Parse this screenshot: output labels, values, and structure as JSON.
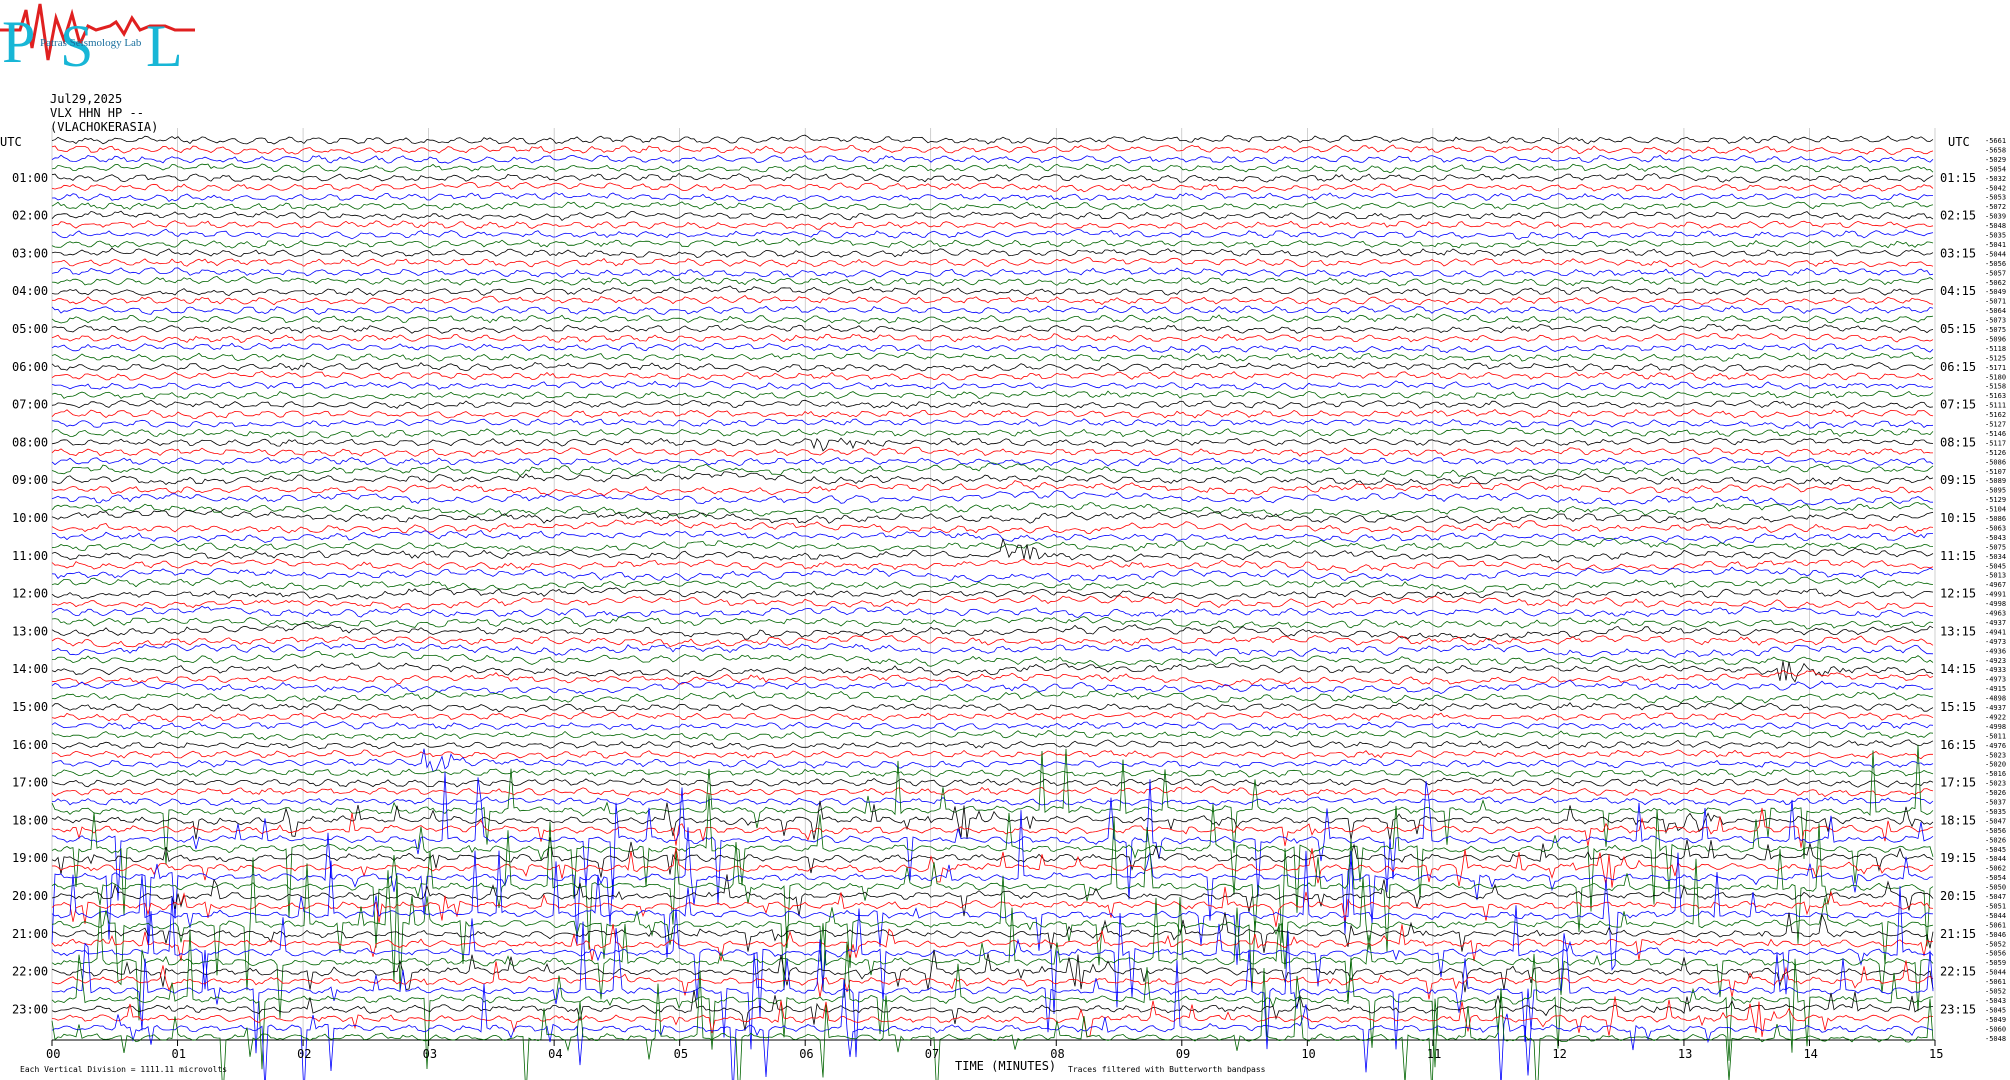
{
  "header": {
    "logo_letters": [
      "P",
      "S",
      "L"
    ],
    "logo_text": "Patras Seismology Lab",
    "date": "Jul29,2025",
    "station": "VLX HHN HP --",
    "location": "(VLACHOKERASIA)"
  },
  "chart_data": {
    "type": "line",
    "title": "",
    "xlabel": "TIME (MINUTES)",
    "ylabel": "UTC",
    "x_ticks": [
      "00",
      "01",
      "02",
      "03",
      "04",
      "05",
      "06",
      "07",
      "08",
      "09",
      "10",
      "11",
      "12",
      "13",
      "14",
      "15"
    ],
    "xlim": [
      0,
      15
    ],
    "left_labels": [
      "01:00",
      "02:00",
      "03:00",
      "04:00",
      "05:00",
      "06:00",
      "07:00",
      "08:00",
      "09:00",
      "10:00",
      "11:00",
      "12:00",
      "13:00",
      "14:00",
      "15:00",
      "16:00",
      "17:00",
      "18:00",
      "19:00",
      "20:00",
      "21:00",
      "22:00",
      "23:00"
    ],
    "right_labels": [
      "01:15",
      "02:15",
      "03:15",
      "04:15",
      "05:15",
      "06:15",
      "07:15",
      "08:15",
      "09:15",
      "10:15",
      "11:15",
      "12:15",
      "13:15",
      "14:15",
      "15:15",
      "16:15",
      "17:15",
      "18:15",
      "19:15",
      "20:15",
      "21:15",
      "22:15",
      "23:15"
    ],
    "utc_label": "UTC",
    "trace_count": 96,
    "trace_colors": [
      "#000000",
      "#ff0000",
      "#0000ff",
      "#006400"
    ],
    "trace_offsets": [
      "-5661",
      "-5658",
      "-5029",
      "-5054",
      "-5032",
      "-5042",
      "-5053",
      "-5072",
      "-5039",
      "-5048",
      "-5035",
      "-5041",
      "-5044",
      "-5056",
      "-5057",
      "-5062",
      "-5049",
      "-5071",
      "-5064",
      "-5073",
      "-5075",
      "-5096",
      "-5118",
      "-5125",
      "-5171",
      "-5180",
      "-5158",
      "-5163",
      "-5111",
      "-5162",
      "-5127",
      "-5146",
      "-5117",
      "-5126",
      "-5086",
      "-5107",
      "-5089",
      "-5095",
      "-5129",
      "-5104",
      "-5086",
      "-5063",
      "-5043",
      "-5075",
      "-5034",
      "-5045",
      "-5013",
      "-4967",
      "-4991",
      "-4998",
      "-4963",
      "-4937",
      "-4941",
      "-4973",
      "-4936",
      "-4923",
      "-4933",
      "-4973",
      "-4915",
      "-4898",
      "-4937",
      "-4922",
      "-4998",
      "-5011",
      "-4976",
      "-5023",
      "-5020",
      "-5016",
      "-5023",
      "-5026",
      "-5037",
      "-5035",
      "-5047",
      "-5056",
      "-5026",
      "-5045",
      "-5044",
      "-5062",
      "-5054",
      "-5050",
      "-5047",
      "-5051",
      "-5044",
      "-5061",
      "-5046",
      "-5052",
      "-5056",
      "-5059",
      "-5044",
      "-5061",
      "-5052",
      "-5043",
      "-5045",
      "-5049",
      "-5060",
      "-5048"
    ],
    "events": [
      {
        "time": "08:00",
        "minute": 6.1
      },
      {
        "time": "11:00",
        "minute": 7.6
      },
      {
        "time": "14:00",
        "minute": 13.8
      },
      {
        "time": "16:30",
        "minute": 3.0
      },
      {
        "time": "18:00",
        "minute": 13.0
      }
    ],
    "footer_scale": "Each Vertical Division = 1111.11 microvolts",
    "footer_note": "Traces filtered with Butterworth bandpass"
  }
}
